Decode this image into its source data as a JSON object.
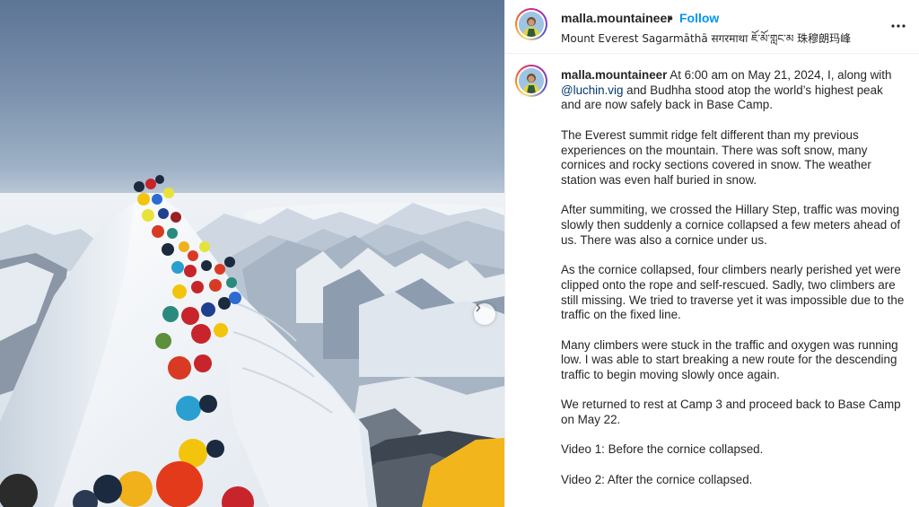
{
  "post": {
    "username": "malla.mountaineer",
    "separator": "•",
    "follow_label": "Follow",
    "location": "Mount Everest Sagarmāthā सगरमाथा ཇོ་མོ་གླང་མ 珠穆朗玛峰",
    "more_icon": "more-horizontal-icon",
    "next_icon": "chevron-right-icon"
  },
  "caption": {
    "username": "malla.mountaineer",
    "intro_pre": " At 6:00 am on May 21, 2024, I, along with ",
    "mention": "@luchin.vig",
    "intro_post": " and Budhha stood atop the world’s highest peak and are now safely back in Base Camp.",
    "paragraphs": [
      "The Everest summit ridge felt different than my previous experiences on the mountain. There was soft snow, many cornices and rocky sections covered in snow. The weather station was even half buried in snow.",
      "After summiting, we crossed the Hillary Step, traffic was moving slowly then suddenly a cornice collapsed a few meters ahead of us. There was also a cornice under us.",
      "As the cornice collapsed, four climbers nearly perished yet were clipped onto the rope and self-rescued. Sadly, two climbers are still missing. We tried to traverse yet it was impossible due to the traffic on the fixed line.",
      "Many climbers were stuck in the traffic and oxygen was running low. I was able to start breaking a new route for the descending traffic to begin moving slowly once again.",
      "We returned to rest at Camp 3 and proceed back to Base Camp on May 22.",
      "Video 1: Before the cornice collapsed.",
      "Video 2: After the cornice collapsed."
    ]
  },
  "colors": {
    "follow": "#0095f6",
    "mention": "#00376b",
    "text": "#262626"
  }
}
